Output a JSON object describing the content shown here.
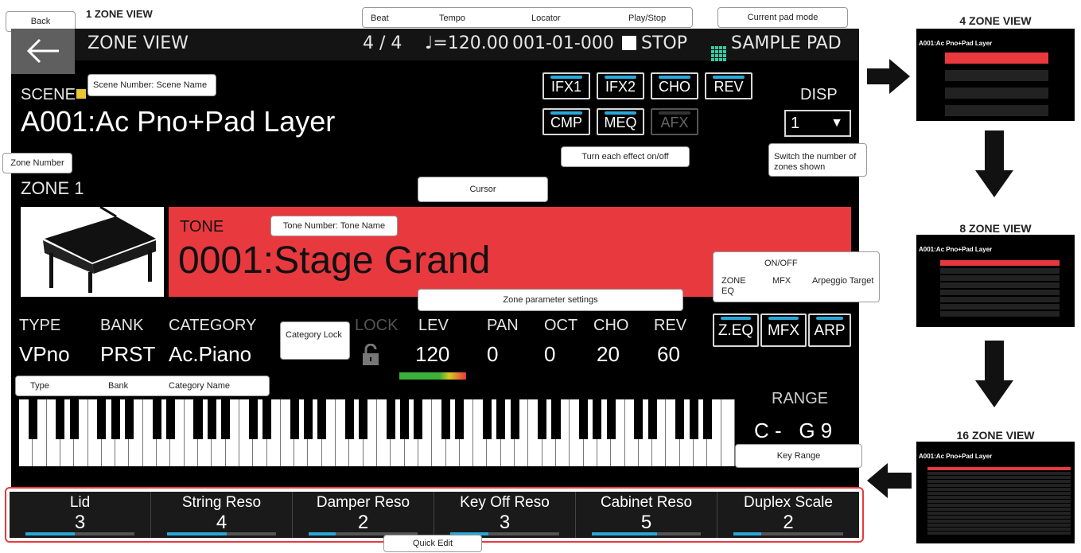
{
  "section_title": "1 ZONE VIEW",
  "callouts": {
    "back": "Back",
    "beat": "Beat",
    "tempo": "Tempo",
    "locator": "Locator",
    "play_stop": "Play/Stop",
    "current_pad_mode": "Current pad mode",
    "scene_number_name": "Scene Number: Scene Name",
    "turn_effect": "Turn each effect on/off",
    "switch_zones": "Switch the number of zones shown",
    "zone_number": "Zone Number",
    "cursor": "Cursor",
    "tone_number_name": "Tone Number: Tone Name",
    "on_off": "ON/OFF",
    "zone_eq": "ZONE EQ",
    "mfx": "MFX",
    "arpeggio_target": "Arpeggio Target",
    "zone_params": "Zone parameter settings",
    "category_lock": "Category Lock",
    "type": "Type",
    "bank": "Bank",
    "category_name": "Category Name",
    "key_range": "Key Range",
    "quick_edit": "Quick Edit"
  },
  "screen": {
    "header_title": "ZONE VIEW",
    "beat": "4 / 4",
    "tempo": "♩=120.00",
    "locator": "001-01-000",
    "play_state": "STOP",
    "pad_mode": "SAMPLE PAD",
    "scene_label": "SCENE",
    "scene_name": "A001:Ac Pno+Pad Layer",
    "effects_row1": [
      "IFX1",
      "IFX2",
      "CHO",
      "REV"
    ],
    "effects_row2": [
      "CMP",
      "MEQ",
      "AFX"
    ],
    "disp_label": "DISP",
    "disp_value": "1",
    "zone_label": "ZONE 1",
    "tone_label": "TONE",
    "tone_name": "0001:Stage Grand",
    "params": {
      "type_h": "TYPE",
      "type_v": "VPno",
      "bank_h": "BANK",
      "bank_v": "PRST",
      "category_h": "CATEGORY",
      "category_v": "Ac.Piano",
      "lock_h": "LOCK",
      "lev_h": "LEV",
      "lev_v": "120",
      "pan_h": "PAN",
      "pan_v": "0",
      "oct_h": "OCT",
      "oct_v": "0",
      "cho_h": "CHO",
      "cho_v": "20",
      "rev_h": "REV",
      "rev_v": "60"
    },
    "zone_buttons": [
      "Z.EQ",
      "MFX",
      "ARP"
    ],
    "range_label": "RANGE",
    "range_value": "C -   G 9"
  },
  "quick_edit": [
    {
      "name": "Lid",
      "value": "3",
      "level": 0.45
    },
    {
      "name": "String Reso",
      "value": "4",
      "level": 0.55
    },
    {
      "name": "Damper Reso",
      "value": "2",
      "level": 0.25
    },
    {
      "name": "Key Off Reso",
      "value": "3",
      "level": 0.35
    },
    {
      "name": "Cabinet Reso",
      "value": "5",
      "level": 0.6
    },
    {
      "name": "Duplex Scale",
      "value": "2",
      "level": 0.25
    }
  ],
  "views": {
    "four": "4 ZONE VIEW",
    "eight": "8 ZONE VIEW",
    "sixteen": "16 ZONE VIEW"
  },
  "thumb_scene": "A001:Ac Pno+Pad Layer",
  "colors": {
    "accent_red": "#e8393f",
    "led_blue": "#28a9d9",
    "pad_green": "#36c9a3"
  }
}
